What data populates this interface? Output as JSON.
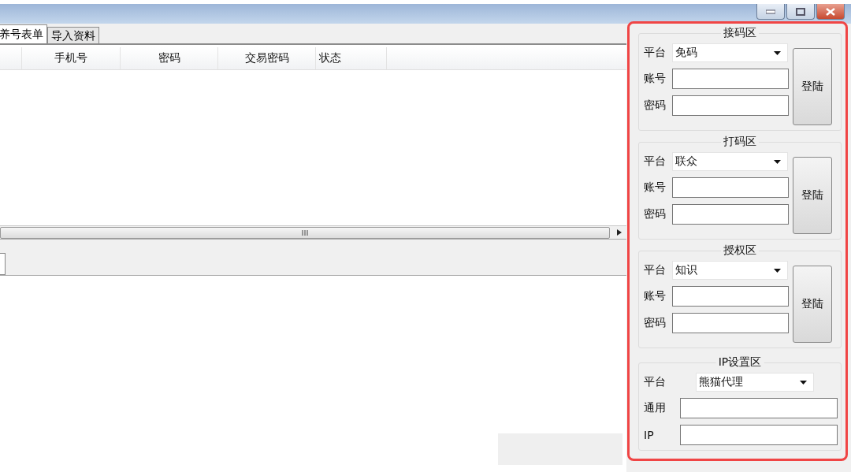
{
  "tabs": [
    {
      "label": "养号表单",
      "selected": true
    },
    {
      "label": "导入资料",
      "selected": false
    }
  ],
  "table": {
    "columns": [
      "手机号",
      "密码",
      "交易密码",
      "状态"
    ]
  },
  "panel": {
    "groups": [
      {
        "title": "接码区",
        "kind": "login",
        "button": "登陆",
        "fields": [
          {
            "label": "平台",
            "kind": "select",
            "value": "免码"
          },
          {
            "label": "账号",
            "kind": "input"
          },
          {
            "label": "密码",
            "kind": "input"
          }
        ]
      },
      {
        "title": "打码区",
        "kind": "login",
        "button": "登陆",
        "fields": [
          {
            "label": "平台",
            "kind": "select",
            "value": "联众"
          },
          {
            "label": "账号",
            "kind": "input"
          },
          {
            "label": "密码",
            "kind": "input"
          }
        ]
      },
      {
        "title": "授权区",
        "kind": "login",
        "button": "登陆",
        "fields": [
          {
            "label": "平台",
            "kind": "select",
            "value": "知识"
          },
          {
            "label": "账号",
            "kind": "input"
          },
          {
            "label": "密码",
            "kind": "input"
          }
        ]
      },
      {
        "title": "IP设置区",
        "kind": "proxy",
        "fields": [
          {
            "label": "平台",
            "kind": "select",
            "value": "熊猫代理"
          },
          {
            "label": "通用",
            "kind": "input"
          },
          {
            "label": "IP",
            "kind": "input"
          }
        ]
      }
    ]
  }
}
